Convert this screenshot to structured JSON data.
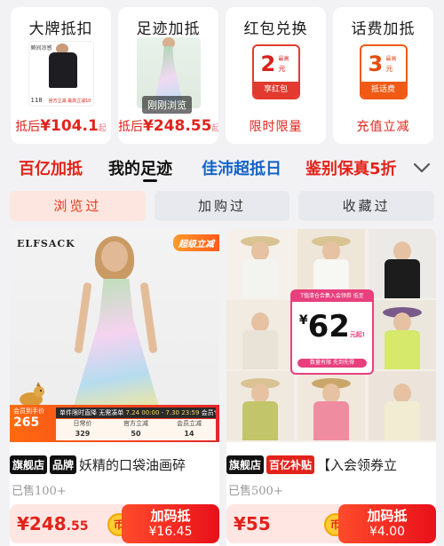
{
  "promo_cards": [
    {
      "title": "大牌抵扣",
      "footer_label": "抵后",
      "footer_price": "¥104.1",
      "footer_suffix": "起",
      "image": {
        "caption_tl": "瞬间凉感",
        "tag_bl": "118",
        "tag_br": "官方立减 最高立减10%"
      }
    },
    {
      "title": "足迹加抵",
      "footer_label": "抵后",
      "footer_price": "¥248.55",
      "footer_suffix": "起",
      "badge": "刚刚浏览"
    },
    {
      "title": "红包兑换",
      "coupon_value": "2",
      "coupon_unit_top": "最高",
      "coupon_unit": "元",
      "coupon_foot": "享红包",
      "footer_text": "限时限量"
    },
    {
      "title": "话费加抵",
      "coupon_value": "3",
      "coupon_unit_top": "最高",
      "coupon_unit": "元",
      "coupon_foot": "抵话费",
      "footer_text": "充值立减"
    }
  ],
  "tabs": [
    {
      "label": "百亿加抵",
      "color": "#e2231a"
    },
    {
      "label": "我的足迹",
      "color": "#111111",
      "active": true
    },
    {
      "label": "佳沛超抵日",
      "color": "#1463c8"
    },
    {
      "label": "鉴别保真5折",
      "color": "#e2231a"
    }
  ],
  "filters": [
    {
      "label": "浏览过",
      "active": true
    },
    {
      "label": "加购过",
      "active": false
    },
    {
      "label": "收藏过",
      "active": false
    }
  ],
  "products": [
    {
      "brand_logo": "ELFSACK",
      "brand_sub": "",
      "super_badge": "超级立减",
      "banner_top": "单件限时直降 无需凑单",
      "banner_time": "7.24 00:00 - 7.30 23:59",
      "banner_tag": "会员专享折上折",
      "member_label": "会员到手价",
      "member_price": "265",
      "table": [
        {
          "label": "日常价",
          "value": "329"
        },
        {
          "label": "官方立减",
          "value": "50"
        },
        {
          "label": "会员立减",
          "value": "14"
        }
      ],
      "tags": [
        {
          "text": "旗舰店",
          "style": "black"
        },
        {
          "text": "品牌",
          "style": "black"
        }
      ],
      "title": "妖精的口袋油画碎",
      "sold": "已售100+",
      "price_int": "¥248",
      "price_dec": ".55",
      "coin_label": "币",
      "button_label": "加码抵",
      "button_amount": "¥16.45"
    },
    {
      "promo_header": "T恤清仓合集入会领券 低至",
      "promo_price": "62",
      "promo_yen": "¥",
      "promo_qi": "元起!",
      "promo_footer": "数量有限 先到先得",
      "tags": [
        {
          "text": "旗舰店",
          "style": "black"
        },
        {
          "text": "百亿补贴",
          "style": "red"
        }
      ],
      "title": "【入会领券立",
      "sold": "已售500+",
      "price_int": "¥55",
      "price_dec": "",
      "coin_label": "币",
      "button_label": "加码抵",
      "button_amount": "¥4.00"
    }
  ],
  "icons": {
    "more_tabs": "chevron-down-icon",
    "coin": "coin-icon"
  },
  "colors": {
    "accent_red": "#e2231a",
    "active_filter_bg": "#fde6df",
    "price_bar_bg": "#ffe6e3"
  }
}
